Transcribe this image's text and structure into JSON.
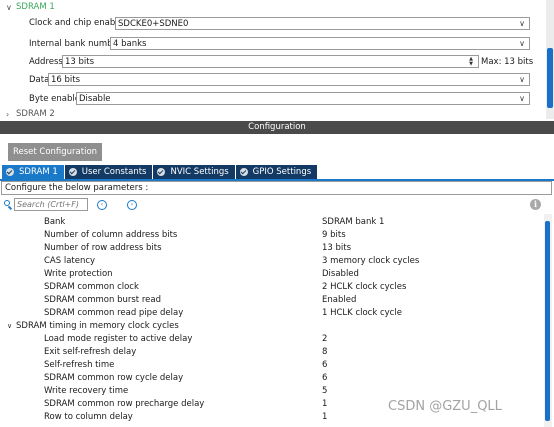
{
  "mode": {
    "section_sdram1": "SDRAM 1",
    "section_sdram2": "SDRAM 2",
    "rows": {
      "clock_chip": {
        "label": "Clock and chip enable",
        "value": "SDCKE0+SDNE0"
      },
      "internal_bank": {
        "label": "Internal bank number",
        "value": "4 banks"
      },
      "address": {
        "label": "Address",
        "value": "13 bits",
        "max": "Max: 13 bits"
      },
      "data": {
        "label": "Data",
        "value": "16 bits"
      },
      "byte_enable": {
        "label": "Byte enable",
        "value": "Disable"
      }
    }
  },
  "config": {
    "header": "Configuration",
    "reset_button": "Reset Configuration",
    "tabs": [
      "SDRAM 1",
      "User Constants",
      "NVIC Settings",
      "GPIO Settings"
    ],
    "banner": "Configure the below parameters :",
    "search_placeholder": "Search (Crtl+F)"
  },
  "params": {
    "rows": [
      {
        "name": "Bank",
        "value": "SDRAM bank 1"
      },
      {
        "name": "Number of column address bits",
        "value": "9 bits"
      },
      {
        "name": "Number of row address bits",
        "value": "13 bits"
      },
      {
        "name": "CAS latency",
        "value": "3 memory clock cycles"
      },
      {
        "name": "Write protection",
        "value": "Disabled"
      },
      {
        "name": "SDRAM common clock",
        "value": "2 HCLK clock cycles"
      },
      {
        "name": "SDRAM common burst read",
        "value": "Enabled"
      },
      {
        "name": "SDRAM common read pipe delay",
        "value": "1 HCLK clock cycle"
      }
    ],
    "group": "SDRAM timing in memory clock cycles",
    "timing_rows": [
      {
        "name": "Load mode register to active delay",
        "value": "2"
      },
      {
        "name": "Exit self-refresh delay",
        "value": "8"
      },
      {
        "name": "Self-refresh time",
        "value": "6"
      },
      {
        "name": "SDRAM common row cycle delay",
        "value": "6"
      },
      {
        "name": "Write recovery time",
        "value": "5"
      },
      {
        "name": "SDRAM common row precharge delay",
        "value": "1"
      },
      {
        "name": "Row to column delay",
        "value": "1"
      }
    ]
  },
  "watermark": "CSDN @GZU_QLL",
  "colors": {
    "accent": "#1a79c9",
    "tab_inactive": "#133a64",
    "section_green": "#39a85b",
    "header_bg": "#4a4a4a"
  }
}
